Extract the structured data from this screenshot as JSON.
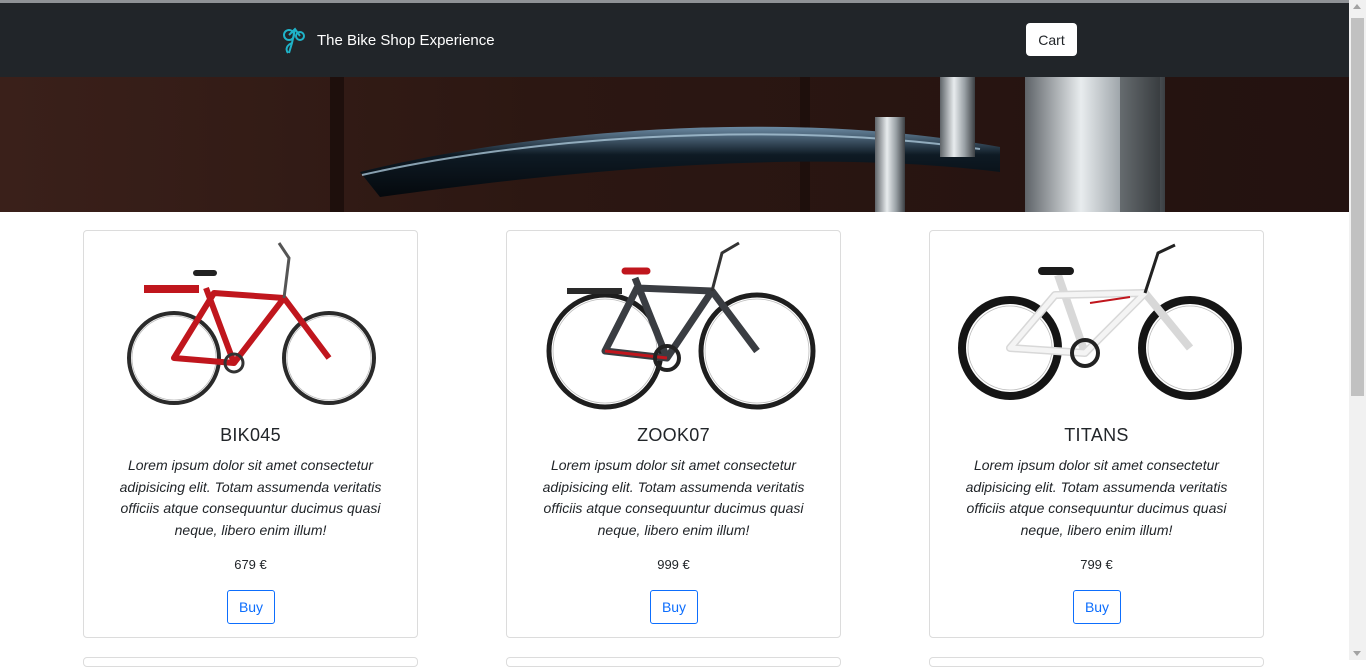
{
  "navbar": {
    "brand": "The Bike Shop Experience",
    "cart_label": "Cart",
    "logo_icon": "bike-logo-icon"
  },
  "hero": {
    "image": "bicycle-fender-photo"
  },
  "products": [
    {
      "name": "BIK045",
      "description": "Lorem ipsum dolor sit amet consectetur adipisicing elit. Totam assumenda veritatis officiis atque consequuntur ducimus quasi neque, libero enim illum!",
      "price": "679 €",
      "buy_label": "Buy",
      "color": "#c0161d"
    },
    {
      "name": "ZOOK07",
      "description": "Lorem ipsum dolor sit amet consectetur adipisicing elit. Totam assumenda veritatis officiis atque consequuntur ducimus quasi neque, libero enim illum!",
      "price": "999 €",
      "buy_label": "Buy",
      "color": "#3a3d42"
    },
    {
      "name": "TITANS",
      "description": "Lorem ipsum dolor sit amet consectetur adipisicing elit. Totam assumenda veritatis officiis atque consequuntur ducimus quasi neque, libero enim illum!",
      "price": "799 €",
      "buy_label": "Buy",
      "color": "#f4f4f4"
    }
  ],
  "colors": {
    "navbar_bg": "#212529",
    "accent": "#0d6efd",
    "logo": "#1fb3c8"
  }
}
